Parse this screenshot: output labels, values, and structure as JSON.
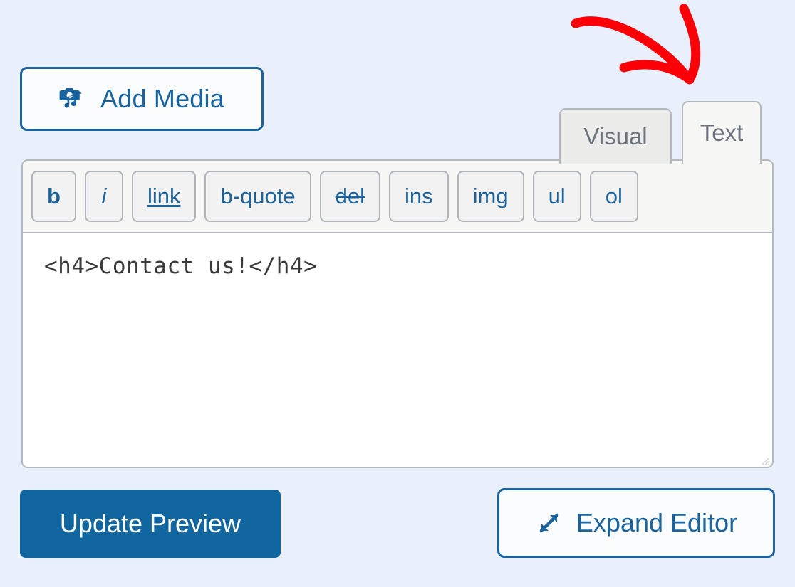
{
  "page": {
    "background_color": "#e9f0fb",
    "accent_blue": "#19639f",
    "button_blue": "#11669f",
    "annotation_color": "#fb0007"
  },
  "toolbar": {
    "add_media_label": "Add Media",
    "add_media_icon": "camera-music-icon"
  },
  "tabs": [
    {
      "label": "Visual",
      "active": false,
      "name": "tab-visual"
    },
    {
      "label": "Text",
      "active": true,
      "name": "tab-text"
    }
  ],
  "quicktags": [
    {
      "label": "b",
      "style": "bold"
    },
    {
      "label": "i",
      "style": "italic"
    },
    {
      "label": "link",
      "style": "underline"
    },
    {
      "label": "b-quote",
      "style": "normal"
    },
    {
      "label": "del",
      "style": "strikethrough"
    },
    {
      "label": "ins",
      "style": "normal"
    },
    {
      "label": "img",
      "style": "normal"
    },
    {
      "label": "ul",
      "style": "normal"
    },
    {
      "label": "ol",
      "style": "normal"
    }
  ],
  "editor": {
    "content": "<h4>Contact us!</h4>",
    "placeholder": "",
    "resize_handle_icon": "resize-grip-icon"
  },
  "actions": {
    "update_label": "Update Preview",
    "expand_label": "Expand Editor",
    "expand_icon": "expand-arrows-icon"
  },
  "annotation": {
    "type": "hand-drawn-arrow",
    "color": "#fb0007",
    "points_to": "tab-text"
  }
}
